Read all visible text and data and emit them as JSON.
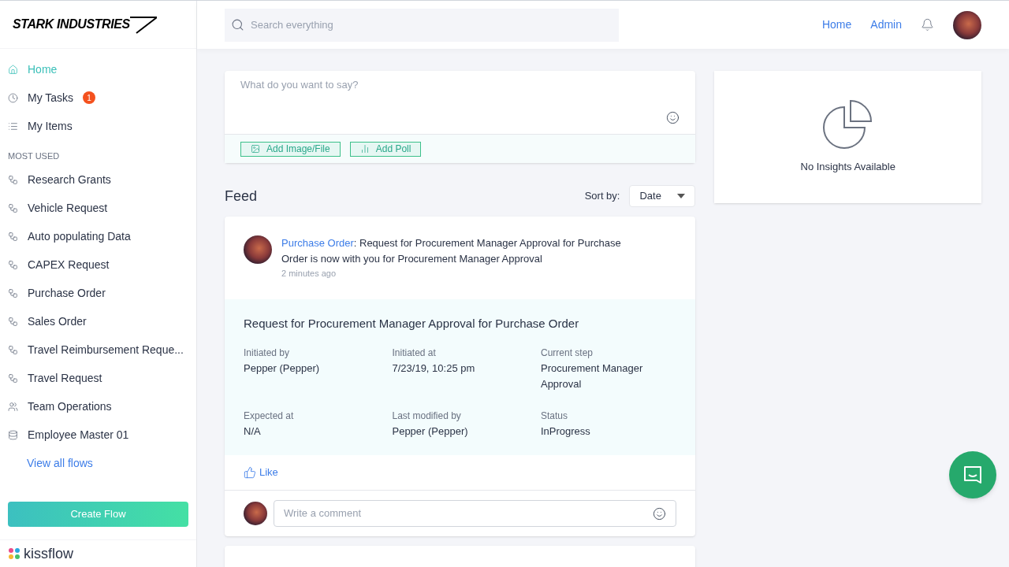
{
  "brand": {
    "logo": "STARK INDUSTRIES",
    "footer_logo": "kissflow"
  },
  "sidebar": {
    "items": [
      {
        "label": "Home",
        "kind": "home",
        "selected": true
      },
      {
        "label": "My Tasks",
        "kind": "clock",
        "selected": false,
        "badge": "1"
      },
      {
        "label": "My Items",
        "kind": "list",
        "selected": false
      }
    ],
    "section_title": "MOST USED",
    "flows": [
      {
        "label": "Research Grants",
        "kind": "flow"
      },
      {
        "label": "Vehicle Request",
        "kind": "flow"
      },
      {
        "label": "Auto populating Data",
        "kind": "flow"
      },
      {
        "label": "CAPEX Request",
        "kind": "flow"
      },
      {
        "label": "Purchase Order",
        "kind": "flow"
      },
      {
        "label": "Sales Order",
        "kind": "flow"
      },
      {
        "label": "Travel Reimbursement Reque...",
        "kind": "flow"
      },
      {
        "label": "Travel Request",
        "kind": "flow"
      },
      {
        "label": "Team Operations",
        "kind": "team"
      },
      {
        "label": "Employee Master 01",
        "kind": "database"
      }
    ],
    "view_all": "View all flows",
    "create_button": "Create Flow"
  },
  "header": {
    "search": {
      "placeholder": "Search everything"
    },
    "links": [
      "Home",
      "Admin"
    ]
  },
  "composer": {
    "placeholder": "What do you want to say?",
    "actions": [
      {
        "label": "Add Image/File",
        "kind": "image"
      },
      {
        "label": "Add Poll",
        "kind": "poll"
      }
    ]
  },
  "feed": {
    "title": "Feed",
    "sort_label": "Sort by:",
    "sort_value": "Date",
    "posts": [
      {
        "flow": "Purchase Order",
        "message": ": Request for Procurement Manager Approval for Purchase Order is now with you for Procurement Manager Approval",
        "time": "2 minutes ago",
        "detail_title": "Request for Procurement Manager Approval for Purchase Order",
        "fields": [
          {
            "label": "Initiated by",
            "value": "Pepper (Pepper)"
          },
          {
            "label": "Initiated at",
            "value": "7/23/19, 10:25 pm"
          },
          {
            "label": "Current step",
            "value": "Procurement Manager Approval"
          },
          {
            "label": "Expected at",
            "value": "N/A"
          },
          {
            "label": "Last modified by",
            "value": "Pepper (Pepper)"
          },
          {
            "label": "Status",
            "value": "InProgress"
          }
        ],
        "like": "Like",
        "comment_placeholder": "Write a comment"
      }
    ]
  },
  "insights": {
    "empty_text": "No Insights Available"
  }
}
